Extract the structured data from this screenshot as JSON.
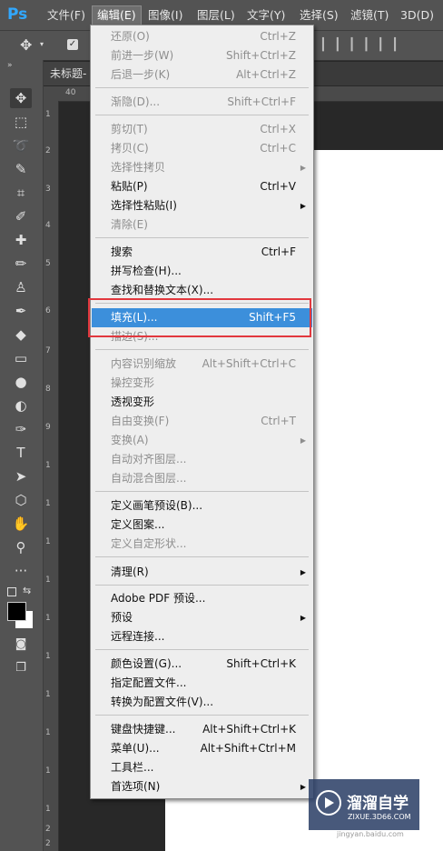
{
  "app": {
    "logo": "Ps"
  },
  "menubar": [
    {
      "label": "文件(F)"
    },
    {
      "label": "编辑(E)"
    },
    {
      "label": "图像(I)"
    },
    {
      "label": "图层(L)"
    },
    {
      "label": "文字(Y)"
    },
    {
      "label": "选择(S)"
    },
    {
      "label": "滤镜(T)"
    },
    {
      "label": "3D(D)"
    }
  ],
  "document": {
    "tab_title": "未标题-"
  },
  "ruler": {
    "top_label": "40",
    "left_labels": [
      "1",
      "2",
      "3",
      "4",
      "5",
      "6",
      "7",
      "8",
      "9",
      "1",
      "1",
      "1",
      "1",
      "1",
      "1",
      "1",
      "1",
      "1",
      "1",
      "2",
      "2"
    ]
  },
  "tools": [
    {
      "icon": "move-icon"
    },
    {
      "icon": "marquee-icon"
    },
    {
      "icon": "lasso-icon"
    },
    {
      "icon": "quick-select-icon"
    },
    {
      "icon": "crop-icon"
    },
    {
      "icon": "eyedropper-icon"
    },
    {
      "icon": "healing-icon"
    },
    {
      "icon": "brush-icon"
    },
    {
      "icon": "stamp-icon"
    },
    {
      "icon": "history-brush-icon"
    },
    {
      "icon": "eraser-icon"
    },
    {
      "icon": "gradient-icon"
    },
    {
      "icon": "blur-icon"
    },
    {
      "icon": "dodge-icon"
    },
    {
      "icon": "pen-icon"
    },
    {
      "icon": "type-icon"
    },
    {
      "icon": "path-select-icon"
    },
    {
      "icon": "shape-icon"
    },
    {
      "icon": "hand-icon"
    },
    {
      "icon": "zoom-icon"
    },
    {
      "icon": "more-icon"
    }
  ],
  "edit_menu": {
    "items": [
      {
        "label": "还原(O)",
        "shortcut": "Ctrl+Z",
        "state": "disabled"
      },
      {
        "label": "前进一步(W)",
        "shortcut": "Shift+Ctrl+Z",
        "state": "disabled"
      },
      {
        "label": "后退一步(K)",
        "shortcut": "Alt+Ctrl+Z",
        "state": "disabled"
      },
      {
        "label": "渐隐(D)...",
        "shortcut": "Shift+Ctrl+F",
        "state": "disabled"
      },
      {
        "label": "剪切(T)",
        "shortcut": "Ctrl+X",
        "state": "disabled"
      },
      {
        "label": "拷贝(C)",
        "shortcut": "Ctrl+C",
        "state": "disabled"
      },
      {
        "label": "选择性拷贝",
        "shortcut": "",
        "state": "disabled",
        "submenu": true
      },
      {
        "label": "粘贴(P)",
        "shortcut": "Ctrl+V",
        "state": "enabled"
      },
      {
        "label": "选择性粘贴(I)",
        "shortcut": "",
        "state": "enabled",
        "submenu": true
      },
      {
        "label": "清除(E)",
        "shortcut": "",
        "state": "disabled"
      },
      {
        "label": "搜索",
        "shortcut": "Ctrl+F",
        "state": "enabled"
      },
      {
        "label": "拼写检查(H)...",
        "shortcut": "",
        "state": "enabled"
      },
      {
        "label": "查找和替换文本(X)...",
        "shortcut": "",
        "state": "enabled"
      },
      {
        "label": "填充(L)...",
        "shortcut": "Shift+F5",
        "state": "highlighted"
      },
      {
        "label": "描边(S)...",
        "shortcut": "",
        "state": "disabled"
      },
      {
        "label": "内容识别缩放",
        "shortcut": "Alt+Shift+Ctrl+C",
        "state": "disabled"
      },
      {
        "label": "操控变形",
        "shortcut": "",
        "state": "disabled"
      },
      {
        "label": "透视变形",
        "shortcut": "",
        "state": "enabled"
      },
      {
        "label": "自由变换(F)",
        "shortcut": "Ctrl+T",
        "state": "disabled"
      },
      {
        "label": "变换(A)",
        "shortcut": "",
        "state": "disabled",
        "submenu": true
      },
      {
        "label": "自动对齐图层...",
        "shortcut": "",
        "state": "disabled"
      },
      {
        "label": "自动混合图层...",
        "shortcut": "",
        "state": "disabled"
      },
      {
        "label": "定义画笔预设(B)...",
        "shortcut": "",
        "state": "enabled"
      },
      {
        "label": "定义图案...",
        "shortcut": "",
        "state": "enabled"
      },
      {
        "label": "定义自定形状...",
        "shortcut": "",
        "state": "disabled"
      },
      {
        "label": "清理(R)",
        "shortcut": "",
        "state": "enabled",
        "submenu": true
      },
      {
        "label": "Adobe PDF 预设...",
        "shortcut": "",
        "state": "enabled"
      },
      {
        "label": "预设",
        "shortcut": "",
        "state": "enabled",
        "submenu": true
      },
      {
        "label": "远程连接...",
        "shortcut": "",
        "state": "enabled"
      },
      {
        "label": "颜色设置(G)...",
        "shortcut": "Shift+Ctrl+K",
        "state": "enabled"
      },
      {
        "label": "指定配置文件...",
        "shortcut": "",
        "state": "enabled"
      },
      {
        "label": "转换为配置文件(V)...",
        "shortcut": "",
        "state": "enabled"
      },
      {
        "label": "键盘快捷键...",
        "shortcut": "Alt+Shift+Ctrl+K",
        "state": "enabled"
      },
      {
        "label": "菜单(U)...",
        "shortcut": "Alt+Shift+Ctrl+M",
        "state": "enabled"
      },
      {
        "label": "工具栏...",
        "shortcut": "",
        "state": "enabled"
      },
      {
        "label": "首选项(N)",
        "shortcut": "",
        "state": "enabled",
        "submenu": true
      }
    ]
  },
  "watermark": {
    "title": "溜溜自学",
    "subtitle": "ZIXUE.3D66.COM",
    "url": "jingyan.baidu.com"
  },
  "colors": {
    "highlight": "#3c8fdb",
    "annotation_box": "#e2383e",
    "menu_bg": "#eeeeee"
  }
}
